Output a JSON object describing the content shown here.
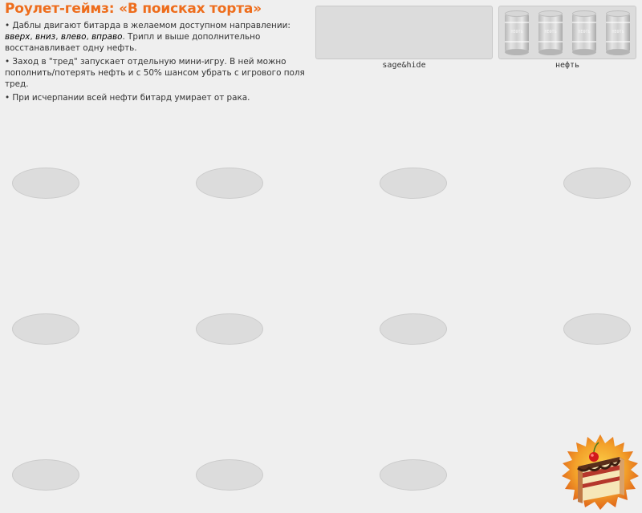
{
  "header": {
    "title": "Роулет-геймз: «В поисках торта»"
  },
  "rules": {
    "line1_pre": "• Даблы двигают битарда в желаемом доступном направлении: ",
    "dir_up": "вверх",
    "sep1": ", ",
    "dir_down": "вниз",
    "sep2": ", ",
    "dir_left": "влево",
    "sep3": ", ",
    "dir_right": "вправо",
    "line1_post": ". Трипл и выше дополнительно восстанавливает одну нефть.",
    "line2": "• Заход в \"тред\" запускает отдельную мини-игру. В ней можно пополнить/потерять нефть и с 50% шансом убрать с игрового поля тред.",
    "line3": "• При исчерпании всей нефти битард умирает от рака."
  },
  "panels": {
    "sage_label": "sage&hide",
    "oil_label": "нефть",
    "barrel_text": "НЕФТЬ"
  },
  "board": {
    "cell_count": 11
  },
  "colors": {
    "title": "#ee6d1c",
    "cell": "#dcdcdc",
    "badge": "#f08a1c"
  },
  "icons": {
    "goal": "cake-icon",
    "oil": "oil-barrel-icon"
  }
}
